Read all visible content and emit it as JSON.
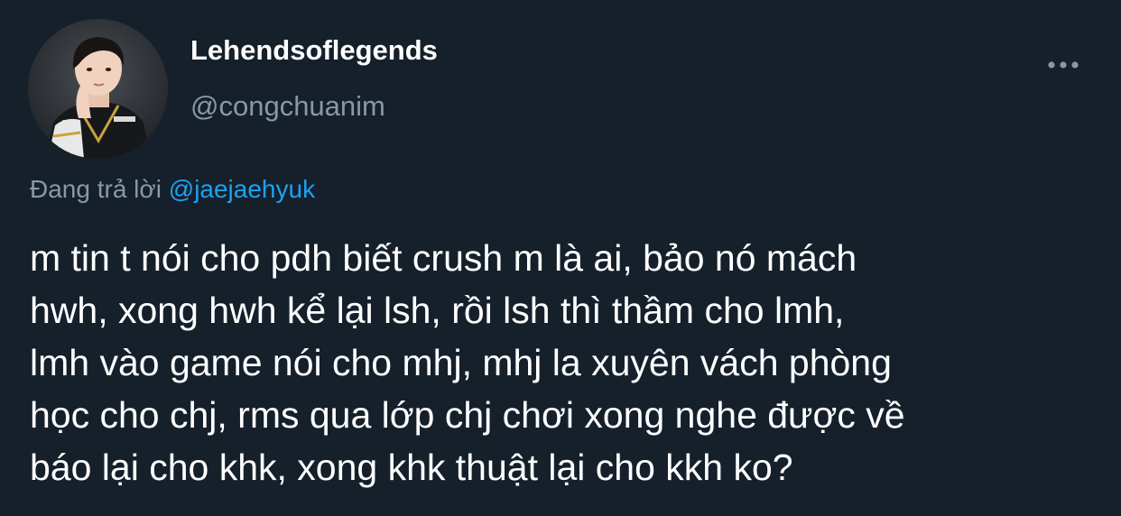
{
  "tweet": {
    "author": {
      "display_name": "Lehendsoflegends",
      "handle": "@congchuanim"
    },
    "reply_to": {
      "prefix": "Đang trả lời ",
      "mention": "@jaejaehyuk"
    },
    "text": "m tin t nói cho pdh biết crush m là ai, bảo nó mách\nhwh, xong hwh kể lại lsh, rồi lsh thì thầm cho lmh,\nlmh vào game nói cho mhj, mhj la xuyên vách phòng\nhọc cho chj, rms qua lớp chj chơi xong nghe được về\nbáo lại cho khk, xong khk thuật lại cho kkh ko?"
  },
  "icons": {
    "more": "more-horizontal-icon",
    "avatar": "profile-photo"
  },
  "colors": {
    "background": "#15202b",
    "text_primary": "#ffffff",
    "text_secondary": "#8899a6",
    "link": "#1da1f2"
  }
}
